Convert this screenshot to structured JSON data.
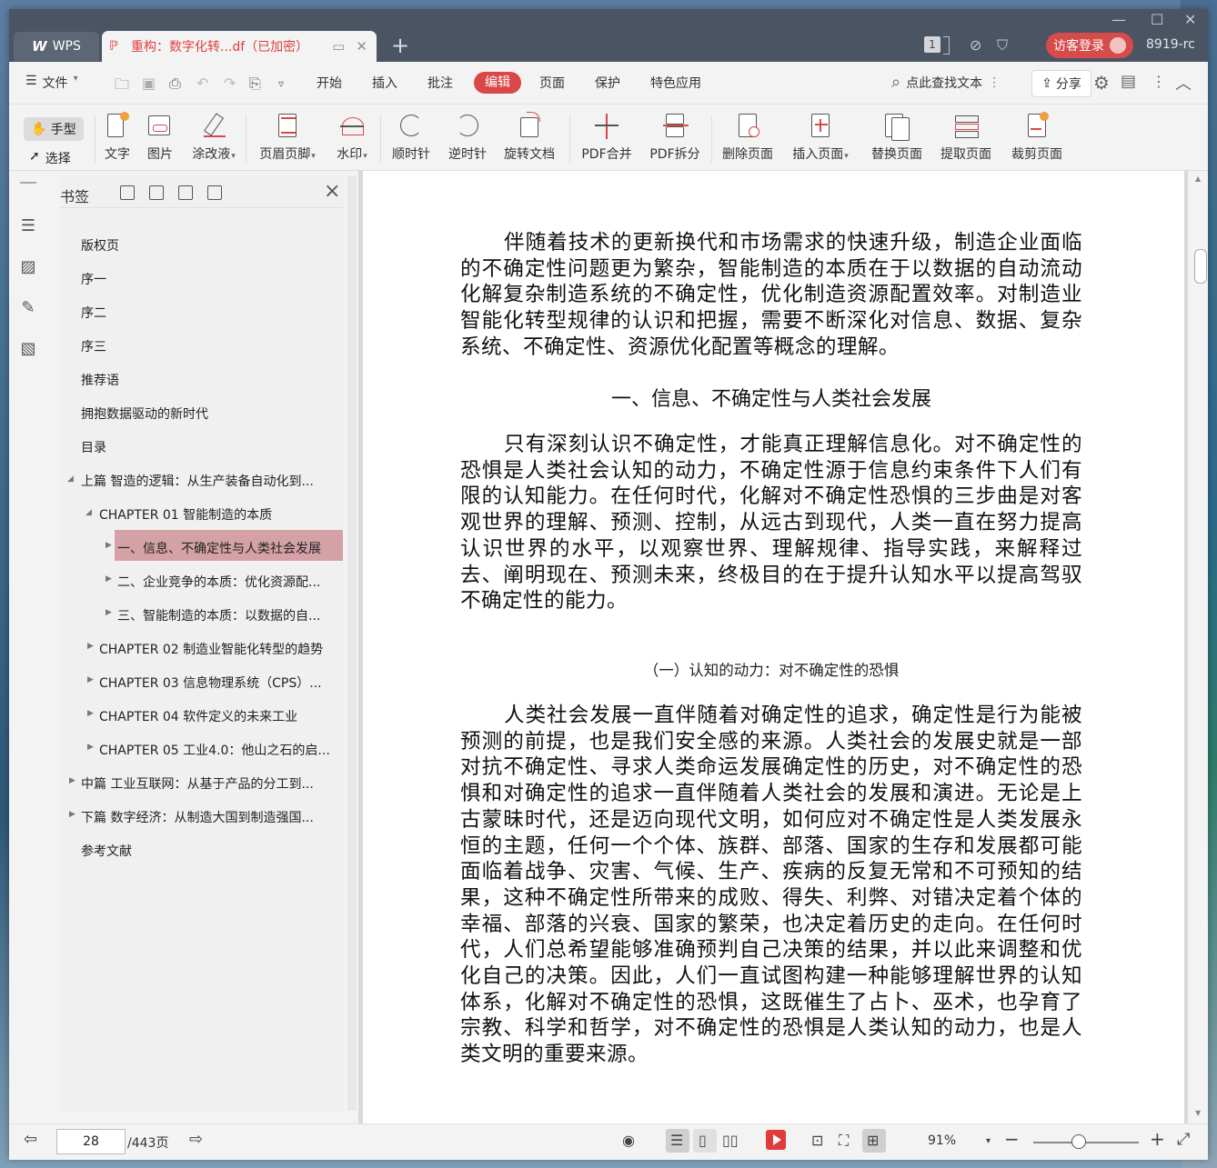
{
  "titlebar": {
    "app_tab": "WPS",
    "doc_tab": "重构：数字化转...df（已加密）",
    "page_count_badge": "1",
    "login_label": "访客登录",
    "username": "8919-rc"
  },
  "menu": {
    "file": "文件",
    "items": [
      "开始",
      "插入",
      "批注",
      "编辑",
      "页面",
      "保护",
      "特色应用"
    ],
    "active": "编辑",
    "search": "点此查找文本",
    "share": "分享"
  },
  "ribbon": {
    "hand": "手型",
    "select": "选择",
    "buttons": [
      "文字",
      "图片",
      "涂改液",
      "页眉页脚",
      "水印",
      "顺时针",
      "逆时针",
      "旋转文档",
      "PDF合并",
      "PDF拆分",
      "删除页面",
      "插入页面",
      "替换页面",
      "提取页面",
      "裁剪页面"
    ]
  },
  "panel": {
    "title": "书签",
    "bookmarks": [
      "版权页",
      "序一",
      "序二",
      "序三",
      "推荐语",
      "拥抱数据驱动的新时代",
      "目录",
      "上篇 智造的逻辑：从生产装备自动化到...",
      "CHAPTER 01 智能制造的本质",
      "一、信息、不确定性与人类社会发展",
      "二、企业竞争的本质：优化资源配...",
      "三、智能制造的本质：以数据的自...",
      "CHAPTER 02 制造业智能化转型的趋势",
      "CHAPTER 03 信息物理系统（CPS）...",
      "CHAPTER 04 软件定义的未来工业",
      "CHAPTER 05 工业4.0：他山之石的启...",
      "中篇 工业互联网：从基于产品的分工到...",
      "下篇 数字经济：从制造大国到制造强国...",
      "参考文献"
    ]
  },
  "document": {
    "para1": "伴随着技术的更新换代和市场需求的快速升级，制造企业面临的不确定性问题更为繁杂，智能制造的本质在于以数据的自动流动化解复杂制造系统的不确定性，优化制造资源配置效率。对制造业智能化转型规律的认识和把握，需要不断深化对信息、数据、复杂系统、不确定性、资源优化配置等概念的理解。",
    "heading1": "一、信息、不确定性与人类社会发展",
    "para2": "只有深刻认识不确定性，才能真正理解信息化。对不确定性的恐惧是人类社会认知的动力，不确定性源于信息约束条件下人们有限的认知能力。在任何时代，化解对不确定性恐惧的三步曲是对客观世界的理解、预测、控制，从远古到现代，人类一直在努力提高认识世界的水平，以观察世界、理解规律、指导实践，来解释过去、阐明现在、预测未来，终极目的在于提升认知水平以提高驾驭不确定性的能力。",
    "heading2": "（一）认知的动力：对不确定性的恐惧",
    "para3": "人类社会发展一直伴随着对确定性的追求，确定性是行为能被预测的前提，也是我们安全感的来源。人类社会的发展史就是一部对抗不确定性、寻求人类命运发展确定性的历史，对不确定性的恐惧和对确定性的追求一直伴随着人类社会的发展和演进。无论是上古蒙昧时代，还是迈向现代文明，如何应对不确定性是人类发展永恒的主题，任何一个个体、族群、部落、国家的生存和发展都可能面临着战争、灾害、气候、生产、疾病的反复无常和不可预知的结果，这种不确定性所带来的成败、得失、利弊、对错决定着个体的幸福、部落的兴衰、国家的繁荣，也决定着历史的走向。在任何时代，人们总希望能够准确预判自己决策的结果，并以此来调整和优化自己的决策。因此，人们一直试图构建一种能够理解世界的认知体系，化解对不确定性的恐惧，这既催生了占卜、巫术，也孕育了宗教、科学和哲学，对不确定性的恐惧是人类认知的动力，也是人类文明的重要来源。"
  },
  "status": {
    "page_current": "28",
    "page_total": "/443页",
    "zoom": "91%"
  },
  "colors": {
    "accent": "#d94747",
    "titlebar": "#4b5463",
    "selected_bookmark": "#d4a1a7"
  }
}
